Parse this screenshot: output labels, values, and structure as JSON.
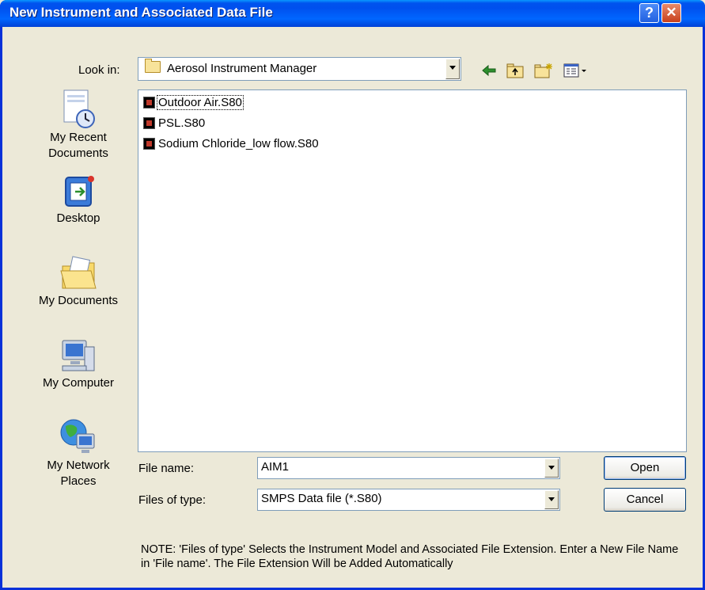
{
  "window": {
    "title": "New Instrument and Associated Data File",
    "help_glyph": "?",
    "close_glyph": "✕"
  },
  "lookin": {
    "label": "Look in:",
    "value": "Aerosol Instrument Manager"
  },
  "toolbar": {
    "icons": [
      "back-arrow-icon",
      "up-folder-icon",
      "new-folder-icon",
      "view-menu-icon"
    ]
  },
  "places": [
    {
      "label_line1": "My Recent",
      "label_line2": "Documents",
      "icon": "recent-documents-icon"
    },
    {
      "label_line1": "Desktop",
      "label_line2": "",
      "icon": "desktop-icon"
    },
    {
      "label_line1": "My Documents",
      "label_line2": "",
      "icon": "my-documents-icon"
    },
    {
      "label_line1": "My Computer",
      "label_line2": "",
      "icon": "my-computer-icon"
    },
    {
      "label_line1": "My Network",
      "label_line2": "Places",
      "icon": "network-places-icon"
    }
  ],
  "files": [
    {
      "name": "Outdoor Air.S80"
    },
    {
      "name": "PSL.S80"
    },
    {
      "name": "Sodium Chloride_low flow.S80"
    }
  ],
  "filename": {
    "label": "File name:",
    "value": "AIM1"
  },
  "filetype": {
    "label": "Files of type:",
    "value": "SMPS Data file (*.S80)"
  },
  "buttons": {
    "open": "Open",
    "cancel": "Cancel"
  },
  "note": "NOTE: 'Files of type' Selects the Instrument Model and Associated File Extension. Enter a New File Name in 'File name'. The File Extension Will be Added Automatically",
  "colors": {
    "titlebar": "#0055ea",
    "dialog_bg": "#ece9d8",
    "field_border": "#7f9db9"
  }
}
